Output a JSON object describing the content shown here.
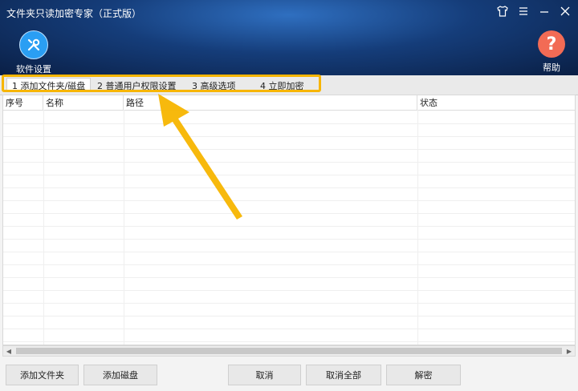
{
  "window": {
    "title": "文件夹只读加密专家（正式版）"
  },
  "toolbar": {
    "settings_label": "软件设置",
    "help_label": "帮助"
  },
  "tabs": [
    {
      "label": "1 添加文件夹/磁盘",
      "active": true
    },
    {
      "label": "2 普通用户权限设置",
      "active": false
    },
    {
      "label": "3 高级选项",
      "active": false
    },
    {
      "label": "4 立即加密",
      "active": false
    }
  ],
  "table": {
    "columns": [
      "序号",
      "名称",
      "路径",
      "状态"
    ],
    "rows": []
  },
  "buttons": {
    "add_folder": "添加文件夹",
    "add_disk": "添加磁盘",
    "cancel": "取消",
    "cancel_all": "取消全部",
    "decrypt": "解密"
  },
  "icons": {
    "settings": "tools-icon",
    "help": "question-icon",
    "skin": "tshirt-icon",
    "menu": "menu-icon",
    "minimize": "minimize-icon",
    "close": "close-icon"
  },
  "colors": {
    "header_dark": "#0a1f45",
    "header_light": "#2f6fc0",
    "settings_icon": "#2a9ef3",
    "help_icon": "#f26b55",
    "highlight": "#f7b500"
  }
}
